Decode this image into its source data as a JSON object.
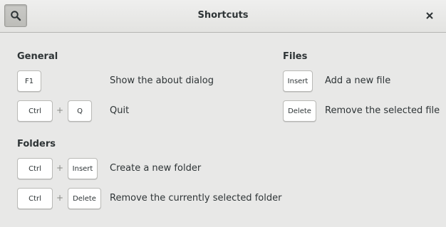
{
  "window": {
    "title": "Shortcuts"
  },
  "icons": {
    "search": "search-icon",
    "close": "close-icon"
  },
  "sections": {
    "general": {
      "title": "General",
      "shortcuts": [
        {
          "keys": [
            "F1"
          ],
          "description": "Show the about dialog"
        },
        {
          "keys": [
            "Ctrl",
            "Q"
          ],
          "description": "Quit"
        }
      ]
    },
    "folders": {
      "title": "Folders",
      "shortcuts": [
        {
          "keys": [
            "Ctrl",
            "Insert"
          ],
          "description": "Create a new folder"
        },
        {
          "keys": [
            "Ctrl",
            "Delete"
          ],
          "description": "Remove the currently selected folder"
        }
      ]
    },
    "files": {
      "title": "Files",
      "shortcuts": [
        {
          "keys": [
            "Insert"
          ],
          "description": "Add a new file"
        },
        {
          "keys": [
            "Delete"
          ],
          "description": "Remove the selected file"
        }
      ]
    }
  },
  "key_separator": "+"
}
